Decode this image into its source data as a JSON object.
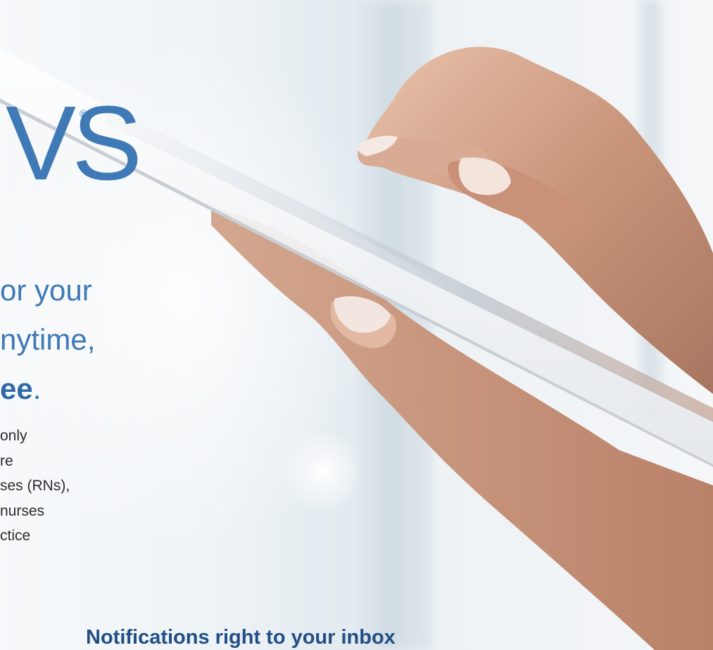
{
  "brand": {
    "wordmark": "VS",
    "registered_mark": "®"
  },
  "headline": {
    "line_1": "or your",
    "line_2": "nytime,",
    "line_3_bold": "ee",
    "line_3_punct": "."
  },
  "body_lines": [
    "only",
    "re",
    "ses (RNs),",
    "nurses",
    "ctice"
  ],
  "footer_heading": "Notifications right to your inbox",
  "colors": {
    "brand_blue": "#3f7ab6",
    "heading_navy": "#214f86",
    "text": "#2c2c2c"
  }
}
